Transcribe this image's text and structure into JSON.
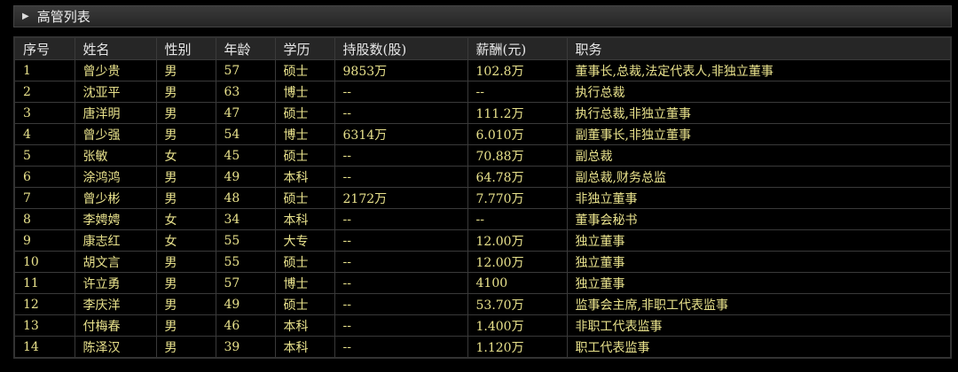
{
  "panel": {
    "title": "高管列表",
    "expand_icon": "triangle-right-icon"
  },
  "table": {
    "headers": [
      "序号",
      "姓名",
      "性别",
      "年龄",
      "学历",
      "持股数(股)",
      "薪酬(元)",
      "职务"
    ],
    "rows": [
      [
        "1",
        "曾少贵",
        "男",
        "57",
        "硕士",
        "9853万",
        "102.8万",
        "董事长,总裁,法定代表人,非独立董事"
      ],
      [
        "2",
        "沈亚平",
        "男",
        "63",
        "博士",
        "--",
        "--",
        "执行总裁"
      ],
      [
        "3",
        "唐洋明",
        "男",
        "47",
        "硕士",
        "--",
        "111.2万",
        "执行总裁,非独立董事"
      ],
      [
        "4",
        "曾少强",
        "男",
        "54",
        "博士",
        "6314万",
        "6.010万",
        "副董事长,非独立董事"
      ],
      [
        "5",
        "张敏",
        "女",
        "45",
        "硕士",
        "--",
        "70.88万",
        "副总裁"
      ],
      [
        "6",
        "涂鸿鸿",
        "男",
        "49",
        "本科",
        "--",
        "64.78万",
        "副总裁,财务总监"
      ],
      [
        "7",
        "曾少彬",
        "男",
        "48",
        "硕士",
        "2172万",
        "7.770万",
        "非独立董事"
      ],
      [
        "8",
        "李娉娉",
        "女",
        "34",
        "本科",
        "--",
        "--",
        "董事会秘书"
      ],
      [
        "9",
        "康志红",
        "女",
        "55",
        "大专",
        "--",
        "12.00万",
        "独立董事"
      ],
      [
        "10",
        "胡文言",
        "男",
        "55",
        "硕士",
        "--",
        "12.00万",
        "独立董事"
      ],
      [
        "11",
        "许立勇",
        "男",
        "57",
        "博士",
        "--",
        "4100",
        "独立董事"
      ],
      [
        "12",
        "李庆洋",
        "男",
        "49",
        "硕士",
        "--",
        "53.70万",
        "监事会主席,非职工代表监事"
      ],
      [
        "13",
        "付梅春",
        "男",
        "46",
        "本科",
        "--",
        "1.400万",
        "非职工代表监事"
      ],
      [
        "14",
        "陈泽汉",
        "男",
        "39",
        "本科",
        "--",
        "1.120万",
        "职工代表监事"
      ]
    ]
  }
}
